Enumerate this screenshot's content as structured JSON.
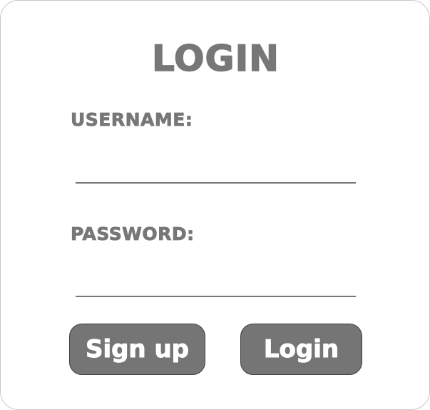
{
  "login_form": {
    "title": "LOGIN",
    "username_label": "USERNAME:",
    "username_value": "",
    "password_label": "PASSWORD:",
    "password_value": "",
    "signup_button_label": "Sign up",
    "login_button_label": "Login"
  }
}
